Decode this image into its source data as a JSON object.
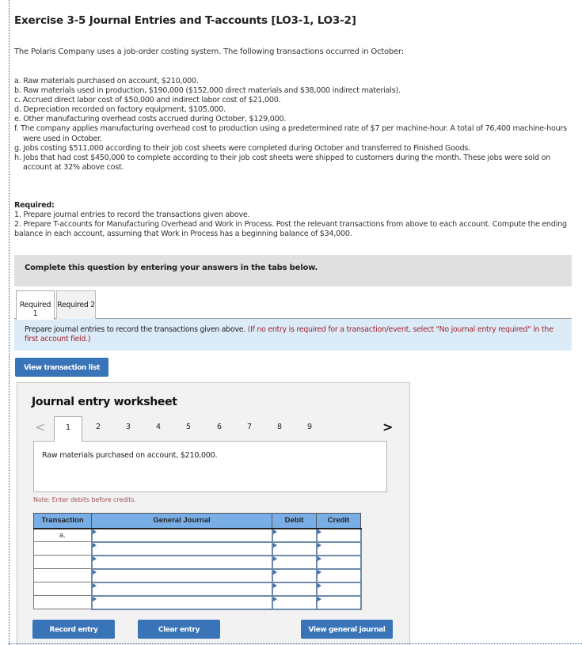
{
  "exercise": {
    "title": "Exercise 3-5 Journal Entries and T-accounts [LO3-1, LO3-2]",
    "intro": "The Polaris Company uses a job-order costing system. The following transactions occurred in October:",
    "transactions": [
      "a. Raw materials purchased on account, $210,000.",
      "b. Raw materials used in production, $190,000 ($152,000 direct materials and $38,000 indirect materials).",
      "c. Accrued direct labor cost of $50,000 and indirect labor cost of $21,000.",
      "d. Depreciation recorded on factory equipment, $105,000.",
      "e. Other manufacturing overhead costs accrued during October, $129,000.",
      "f. The company applies manufacturing overhead cost to production using a predetermined rate of $7 per machine-hour. A total of 76,400 machine-hours were used in October.",
      "g. Jobs costing $511,000 according to their job cost sheets were completed during October and transferred to Finished Goods.",
      "h. Jobs that had cost $450,000 to complete according to their job cost sheets were shipped to customers during the month. These jobs were sold on account at 32% above cost."
    ],
    "required_heading": "Required:",
    "required_items": [
      "1. Prepare journal entries to record the transactions given above.",
      "2. Prepare T-accounts for Manufacturing Overhead and Work in Process. Post the relevant transactions from above to each account. Compute the ending balance in each account, assuming that Work in Process has a beginning balance of $34,000."
    ]
  },
  "banner": "Complete this question by entering your answers in the tabs below.",
  "tabs": [
    {
      "label": "Required 1",
      "active": true
    },
    {
      "label": "Required 2",
      "active": false
    }
  ],
  "instruction": {
    "main": "Prepare journal entries to record the transactions given above.",
    "note": "(If no entry is required for a transaction/event, select \"No journal entry required\" in the first account field.)"
  },
  "buttons": {
    "view_transaction_list": "View transaction list",
    "record_entry": "Record entry",
    "clear_entry": "Clear entry",
    "view_general_journal": "View general journal"
  },
  "worksheet": {
    "title": "Journal entry worksheet",
    "prev_icon": "chevron-left-icon",
    "next_icon": "chevron-right-icon",
    "prev_glyph": "<",
    "next_glyph": ">",
    "pages": [
      "1",
      "2",
      "3",
      "4",
      "5",
      "6",
      "7",
      "8",
      "9"
    ],
    "current_page": "1",
    "entry_description": "Raw materials purchased on account, $210,000.",
    "note": "Note: Enter debits before credits.",
    "table": {
      "headers": [
        "Transaction",
        "General Journal",
        "Debit",
        "Credit"
      ],
      "rows": [
        {
          "transaction": "a.",
          "account": "",
          "debit": "",
          "credit": ""
        },
        {
          "transaction": "",
          "account": "",
          "debit": "",
          "credit": ""
        },
        {
          "transaction": "",
          "account": "",
          "debit": "",
          "credit": ""
        },
        {
          "transaction": "",
          "account": "",
          "debit": "",
          "credit": ""
        },
        {
          "transaction": "",
          "account": "",
          "debit": "",
          "credit": ""
        },
        {
          "transaction": "",
          "account": "",
          "debit": "",
          "credit": ""
        }
      ]
    }
  },
  "colors": {
    "button_blue": "#3a74b8",
    "table_header_blue": "#78aee5",
    "instruction_bg": "#dbebf8",
    "note_red": "#a0252d",
    "banner_gray": "#e0e0e0"
  }
}
